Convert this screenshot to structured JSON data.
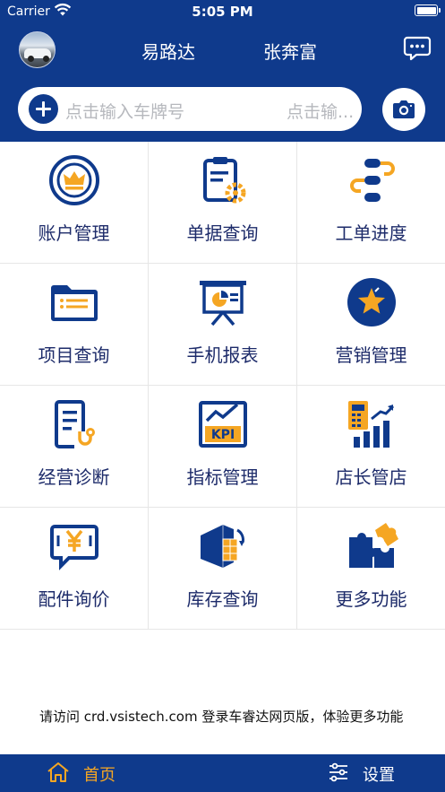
{
  "status_bar": {
    "carrier": "Carrier",
    "time": "5:05 PM"
  },
  "header": {
    "tab_left": "易路达",
    "tab_right": "张奔富",
    "search_placeholder": "点击输入车牌号",
    "search_placeholder_right": "点击输...",
    "accent_color": "#0f3a8c"
  },
  "grid": {
    "items": [
      {
        "label": "账户管理",
        "icon": "crown-badge-icon"
      },
      {
        "label": "单据查询",
        "icon": "clipboard-gear-icon"
      },
      {
        "label": "工单进度",
        "icon": "workflow-icon"
      },
      {
        "label": "项目查询",
        "icon": "folder-list-icon"
      },
      {
        "label": "手机报表",
        "icon": "presentation-chart-icon"
      },
      {
        "label": "营销管理",
        "icon": "star-badge-icon"
      },
      {
        "label": "经营诊断",
        "icon": "stethoscope-document-icon"
      },
      {
        "label": "指标管理",
        "icon": "kpi-icon"
      },
      {
        "label": "店长管店",
        "icon": "calculator-bar-chart-icon"
      },
      {
        "label": "配件询价",
        "icon": "yuan-chat-icon"
      },
      {
        "label": "库存查询",
        "icon": "inventory-box-icon"
      },
      {
        "label": "更多功能",
        "icon": "puzzle-icon"
      }
    ]
  },
  "footer_notice": "请访问 crd.vsistech.com 登录车睿达网页版，体验更多功能",
  "tabbar": {
    "home_label": "首页",
    "settings_label": "设置",
    "active_color": "#f5a623"
  }
}
